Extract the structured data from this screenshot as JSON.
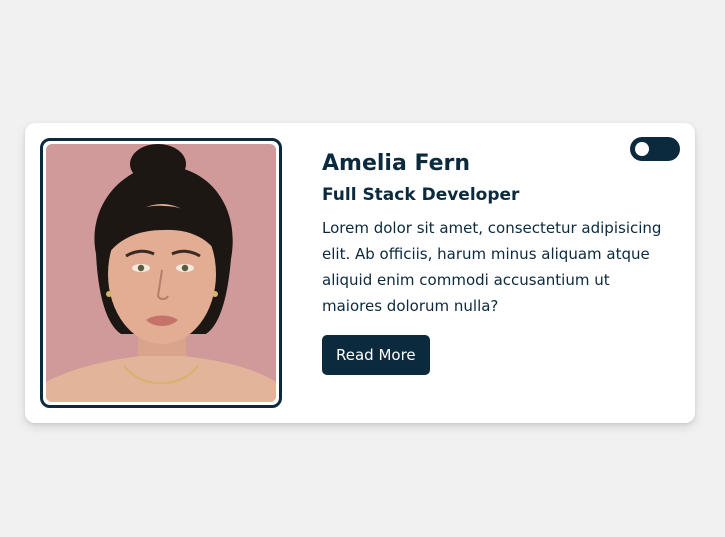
{
  "profile": {
    "name": "Amelia Fern",
    "role": "Full Stack Developer",
    "bio": "Lorem dolor sit amet, consectetur adipisicing elit. Ab officiis, harum minus aliquam atque aliquid enim commodi accusantium ut maiores dolorum nulla?",
    "read_more_label": "Read More",
    "photo_icon": "portrait-photo"
  },
  "toggle": {
    "state": "off",
    "icon": "toggle-switch"
  },
  "colors": {
    "primary": "#0c2a3d",
    "background": "#f1f1f2",
    "card": "#ffffff",
    "photo_backdrop": "#d19a9a"
  }
}
